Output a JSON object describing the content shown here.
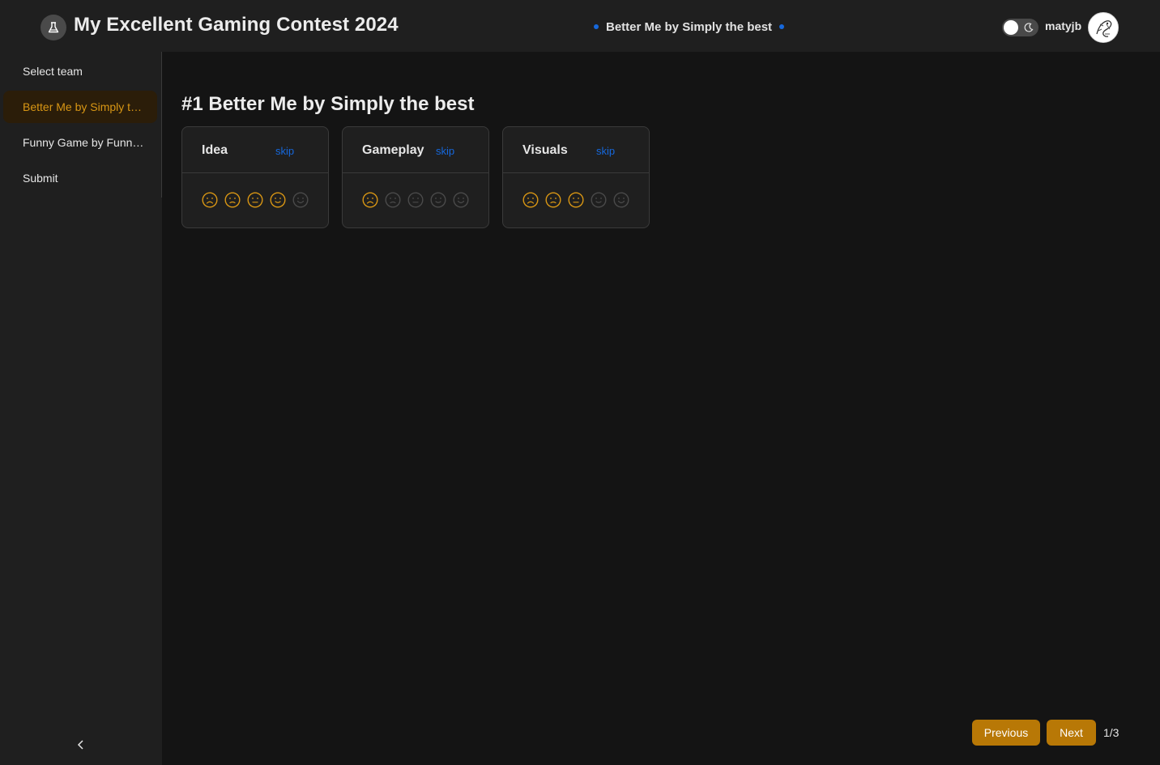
{
  "header": {
    "app_title": "My Excellent Gaming Contest 2024",
    "current_team": "Better Me by Simply the best",
    "username": "matyjb",
    "theme_toggle_icon": "moon-icon",
    "logo_icon": "flask-icon"
  },
  "sidebar": {
    "items": [
      {
        "label": "Select team",
        "active": false
      },
      {
        "label": "Better Me by Simply the best",
        "active": true
      },
      {
        "label": "Funny Game by Funny Team",
        "active": false
      },
      {
        "label": "Submit",
        "active": false
      }
    ],
    "collapse_icon": "chevron-left-icon"
  },
  "main": {
    "title": "#1 Better Me by Simply the best",
    "categories": [
      {
        "name": "Idea",
        "skip_label": "skip",
        "rating": 4,
        "max": 5
      },
      {
        "name": "Gameplay",
        "skip_label": "skip",
        "rating": 1,
        "max": 5
      },
      {
        "name": "Visuals",
        "skip_label": "skip",
        "rating": 3,
        "max": 5
      }
    ]
  },
  "pagination": {
    "previous_label": "Previous",
    "next_label": "Next",
    "page_label": "1/3"
  },
  "colors": {
    "accent": "#d89614",
    "link": "#1668dc",
    "inactive_face": "#4a4a4a"
  }
}
